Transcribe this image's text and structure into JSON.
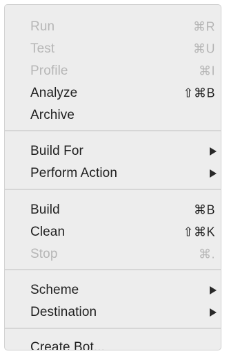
{
  "menu": {
    "items": [
      {
        "label": "Run",
        "shortcut": "⌘R",
        "enabled": false
      },
      {
        "label": "Test",
        "shortcut": "⌘U",
        "enabled": false
      },
      {
        "label": "Profile",
        "shortcut": "⌘I",
        "enabled": false
      },
      {
        "label": "Analyze",
        "shortcut": "⇧⌘B",
        "enabled": true
      },
      {
        "label": "Archive",
        "shortcut": "",
        "enabled": true
      },
      {
        "label": "Build For",
        "submenu": true,
        "enabled": true
      },
      {
        "label": "Perform Action",
        "submenu": true,
        "enabled": true
      },
      {
        "label": "Build",
        "shortcut": "⌘B",
        "enabled": true
      },
      {
        "label": "Clean",
        "shortcut": "⇧⌘K",
        "enabled": true
      },
      {
        "label": "Stop",
        "shortcut": "⌘.",
        "enabled": false
      },
      {
        "label": "Scheme",
        "submenu": true,
        "enabled": true
      },
      {
        "label": "Destination",
        "submenu": true,
        "enabled": true
      },
      {
        "label": "Create Bot...",
        "shortcut": "",
        "enabled": true
      }
    ]
  },
  "colors": {
    "menu_background": "#ededed",
    "text_enabled": "#1f1f1f",
    "text_disabled": "#b6b6b6",
    "separator": "#d6d6d6"
  }
}
